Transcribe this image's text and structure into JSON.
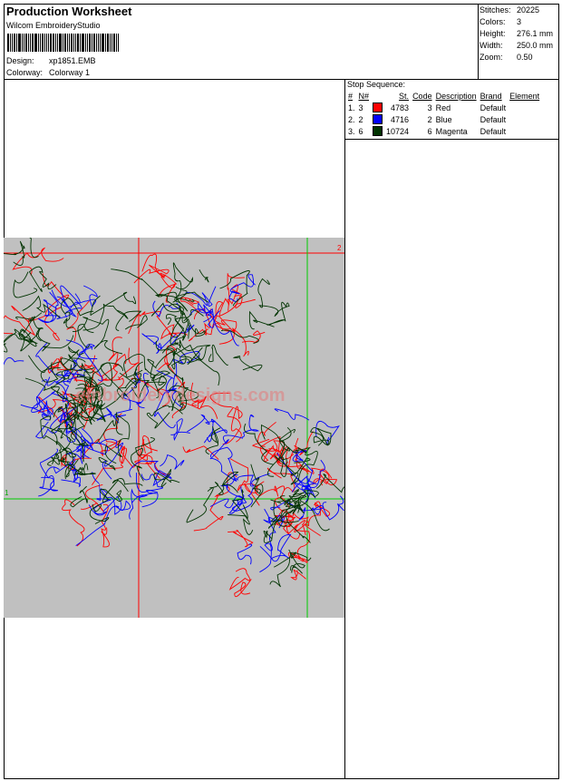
{
  "header": {
    "title": "Production Worksheet",
    "software": "Wilcom EmbroideryStudio"
  },
  "design_info": {
    "design_label": "Design:",
    "design_value": "xp1851.EMB",
    "colorway_label": "Colorway:",
    "colorway_value": "Colorway 1"
  },
  "stats": {
    "stitches_label": "Stitches:",
    "stitches_value": "20225",
    "colors_label": "Colors:",
    "colors_value": "3",
    "height_label": "Height:",
    "height_value": "276.1 mm",
    "width_label": "Width:",
    "width_value": "250.0 mm",
    "zoom_label": "Zoom:",
    "zoom_value": "0.50"
  },
  "stop_sequence": {
    "title": "Stop Sequence:",
    "headers": {
      "index": "#",
      "needle": "N#",
      "stitches": "St.",
      "code": "Code",
      "description": "Description",
      "brand": "Brand",
      "element": "Element"
    },
    "rows": [
      {
        "index": "1.",
        "needle": "3",
        "color": "#ff0000",
        "stitches": "4783",
        "code": "3",
        "description": "Red",
        "brand": "Default"
      },
      {
        "index": "2.",
        "needle": "2",
        "color": "#0000ff",
        "stitches": "4716",
        "code": "2",
        "description": "Blue",
        "brand": "Default"
      },
      {
        "index": "3.",
        "needle": "6",
        "color": "#003300",
        "stitches": "10724",
        "code": "6",
        "description": "Magenta",
        "brand": "Default"
      }
    ]
  },
  "preview": {
    "watermark": "embroiderydesigns.com",
    "axis_label_2": "2",
    "axis_label_1": "1",
    "background": "#c0c0c0",
    "guide_red": "#ff0000",
    "guide_green": "#00cc00"
  }
}
